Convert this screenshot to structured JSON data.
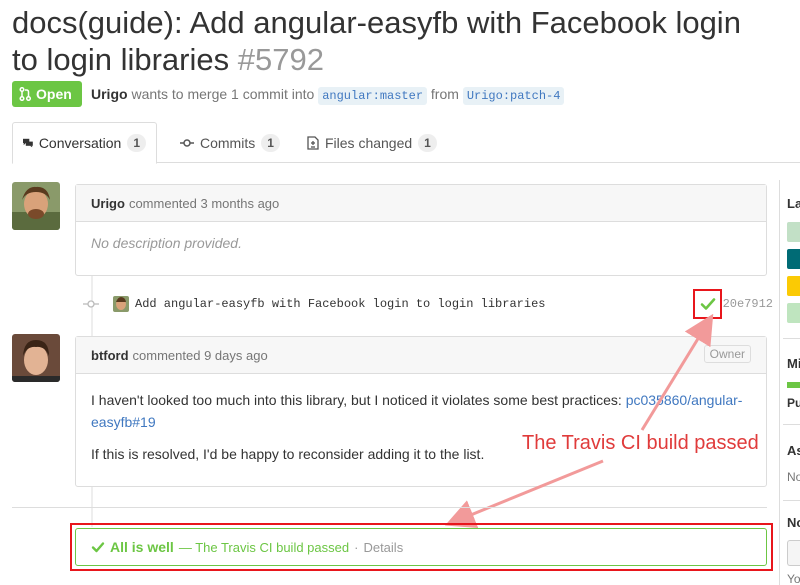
{
  "pr": {
    "title": "docs(guide): Add angular-easyfb with Facebook login to login libraries",
    "number": "#5792",
    "state": "Open",
    "author": "Urigo",
    "merge_text": "wants to merge 1 commit into",
    "base_ref": "angular:master",
    "from_text": "from",
    "head_ref": "Urigo:patch-4"
  },
  "tabs": [
    {
      "label": "Conversation",
      "count": "1"
    },
    {
      "label": "Commits",
      "count": "1"
    },
    {
      "label": "Files changed",
      "count": "1"
    }
  ],
  "comments": [
    {
      "author": "Urigo",
      "meta": "commented 3 months ago",
      "body": "No description provided."
    },
    {
      "author": "btford",
      "meta": "commented 9 days ago",
      "badge": "Owner",
      "body_prefix": "I haven't looked too much into this library, but I noticed it violates some best practices:",
      "body_link": "pc035860/angular-easyfb#19",
      "body_second": "If this is resolved, I'd be happy to reconsider adding it to the list."
    }
  ],
  "commit": {
    "message": "Add angular-easyfb with Facebook login to login libraries",
    "sha": "20e7912"
  },
  "annotation": "The Travis CI build passed",
  "status": {
    "headline": "All is well",
    "detail": "— The Travis CI build passed",
    "sep": "·",
    "details_link": "Details"
  },
  "sidebar": {
    "labels_title": "La",
    "milestone_title": "Mi",
    "milestone_value": "Pu",
    "assignee_title": "As",
    "assignee_value": "No",
    "notifications_title": "No",
    "notifications_value": "Yo"
  },
  "colors": {
    "open_green": "#6cc644",
    "annotation_red": "#e8161c",
    "link_blue": "#4078c0"
  }
}
